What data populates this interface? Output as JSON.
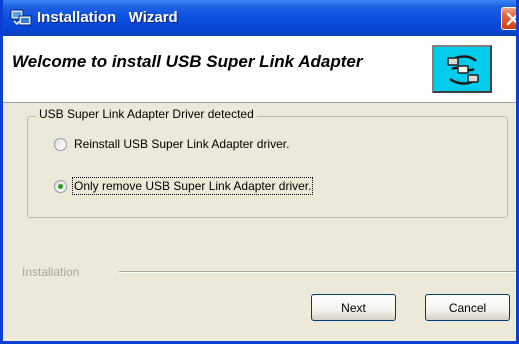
{
  "window": {
    "title": "Installation   Wizard"
  },
  "header": {
    "title": "Welcome to install USB Super Link Adapter",
    "icon": "usb-cable-icon"
  },
  "group": {
    "label": "USB Super Link Adapter Driver detected",
    "options": [
      {
        "label": "Reinstall USB Super Link Adapter driver.",
        "selected": false
      },
      {
        "label": "Only remove USB Super Link Adapter driver.",
        "selected": true
      }
    ]
  },
  "footer": {
    "section_label": "Installation",
    "next_label": "Next",
    "cancel_label": "Cancel"
  },
  "colors": {
    "titlebar": "#0a4fe0",
    "dialog_bg": "#ece9d8",
    "icon_bg": "#00ccee",
    "radio_dot": "#21a121"
  }
}
